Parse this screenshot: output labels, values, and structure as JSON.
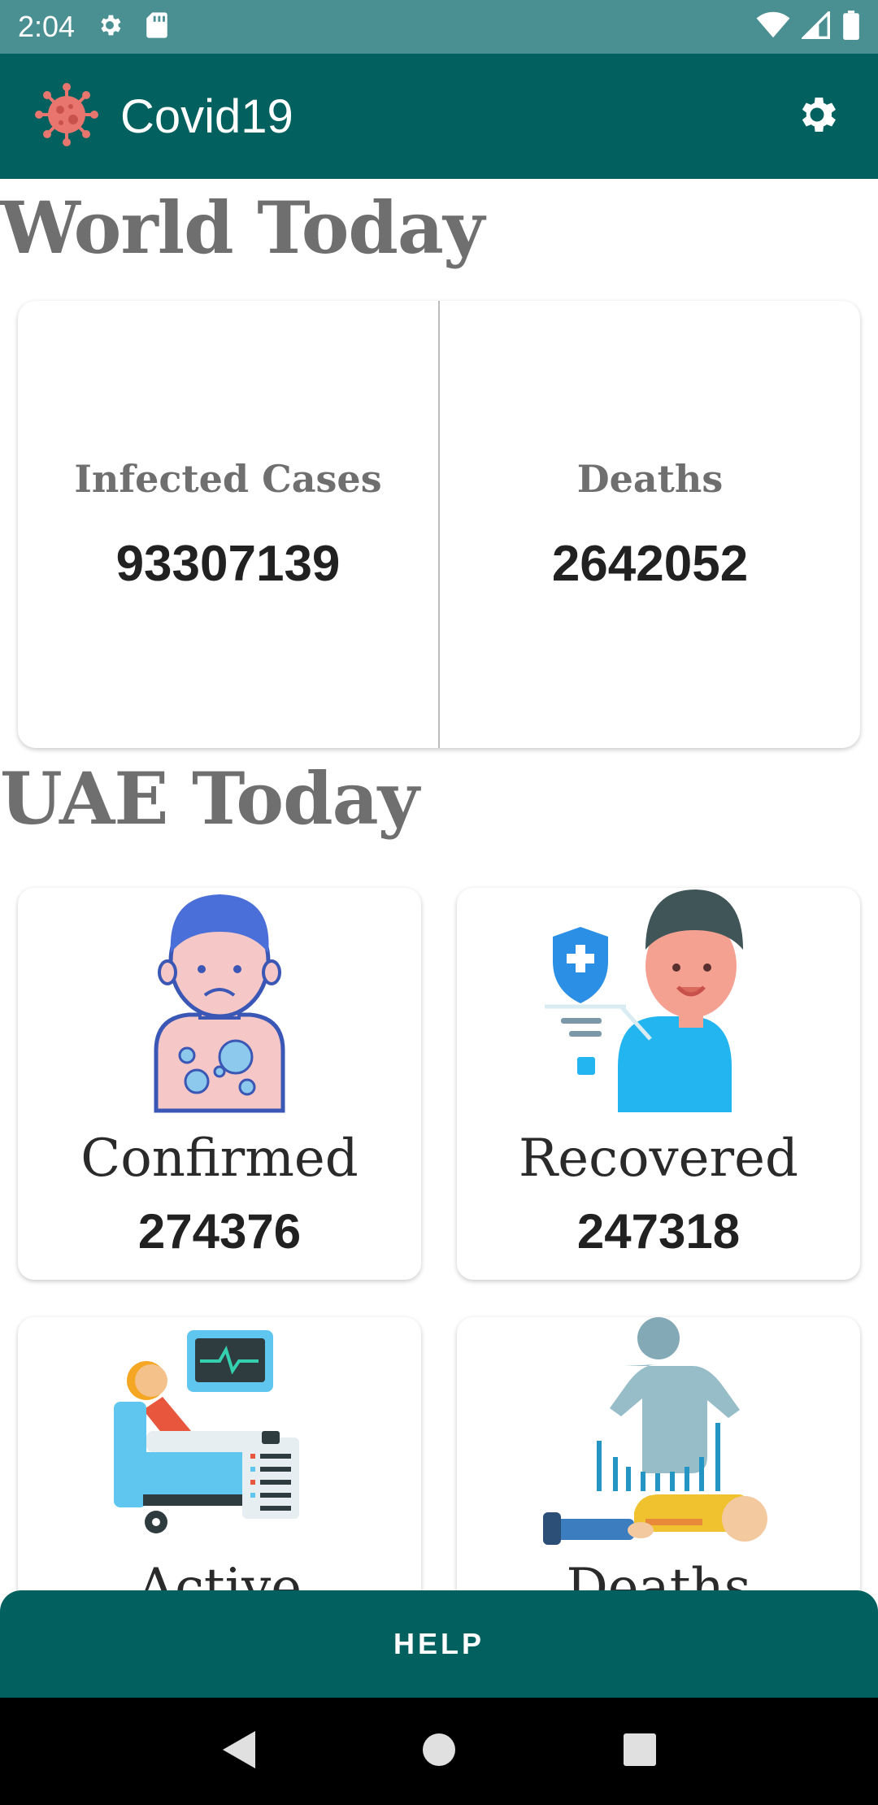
{
  "status_bar": {
    "time": "2:04"
  },
  "app_bar": {
    "title": "Covid19"
  },
  "world": {
    "heading": "World Today",
    "infected_label": "Infected Cases",
    "infected_value": "93307139",
    "deaths_label": "Deaths",
    "deaths_value": "2642052"
  },
  "uae": {
    "heading": "UAE Today",
    "cards": [
      {
        "label": "Confirmed",
        "value": "274376",
        "icon": "sick-person-icon"
      },
      {
        "label": "Recovered",
        "value": "247318",
        "icon": "recovered-person-icon"
      },
      {
        "label": "Active",
        "value": "",
        "icon": "hospital-bed-icon"
      },
      {
        "label": "Deaths",
        "value": "",
        "icon": "deceased-person-icon"
      }
    ]
  },
  "help_button": {
    "label": "HELP"
  },
  "colors": {
    "primary": "#02615f",
    "status_bar": "#4a8f91",
    "heading_gray": "#6f6f6f"
  }
}
